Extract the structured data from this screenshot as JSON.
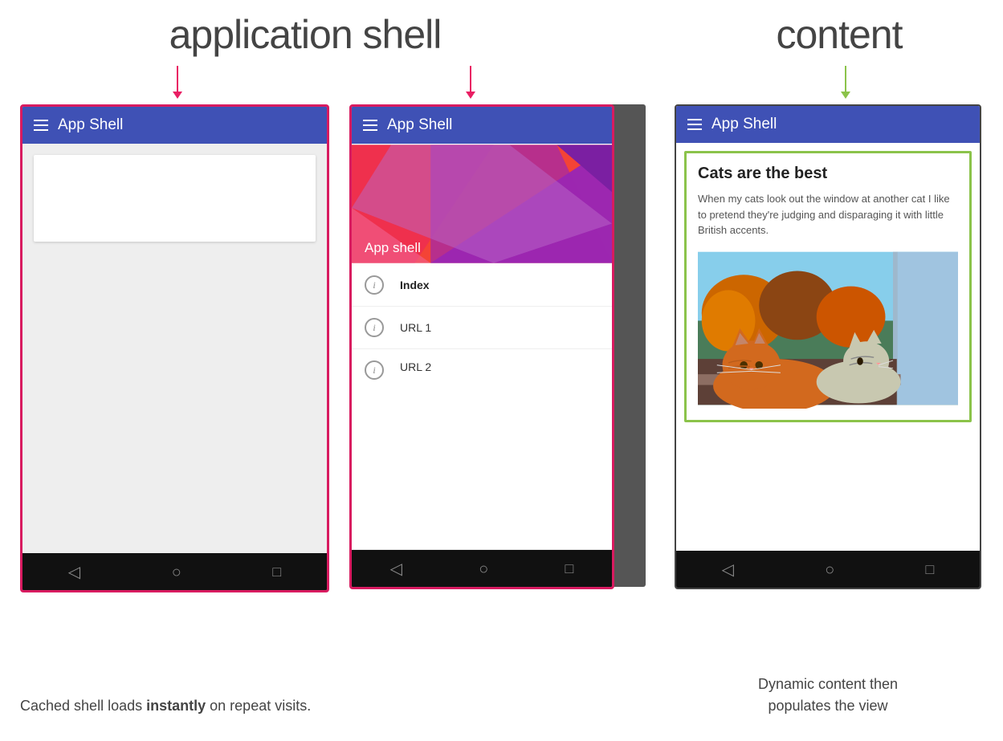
{
  "labels": {
    "application_shell": "application shell",
    "content": "content",
    "cached_caption_1": "Cached shell loads",
    "cached_caption_bold": "instantly",
    "cached_caption_2": "on repeat visits.",
    "dynamic_caption_1": "Dynamic content then",
    "dynamic_caption_2": "populates the view"
  },
  "phone1": {
    "header_title": "App Shell",
    "hamburger": "≡"
  },
  "phone2": {
    "header_title": "App Shell",
    "hamburger": "≡",
    "drawer_label": "App shell",
    "menu_items": [
      {
        "label": "Index",
        "bold": true
      },
      {
        "label": "URL 1",
        "bold": false
      },
      {
        "label": "URL 2",
        "bold": false
      }
    ]
  },
  "phone3": {
    "header_title": "App Shell",
    "hamburger": "≡",
    "content_title": "Cats are the best",
    "content_text": "When my cats look out the window at another cat I like to pretend they're judging and disparaging it with little British accents."
  },
  "colors": {
    "pink_border": "#d81b60",
    "green_border": "#8bc34a",
    "blue_header": "#3f51b5",
    "dark_bar": "#111111",
    "arrow_pink": "#e91e63",
    "arrow_green": "#8bc34a"
  }
}
